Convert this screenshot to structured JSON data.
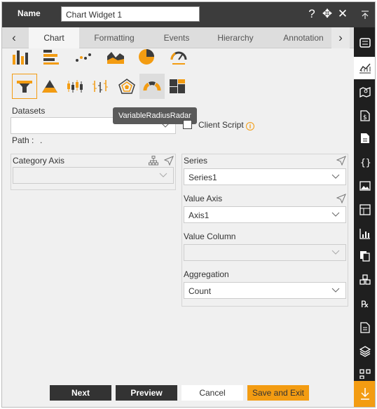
{
  "header": {
    "name_label": "Name",
    "title_value": "Chart Widget 1",
    "help_icon": "question-icon",
    "move_icon": "move-icon",
    "close_icon": "close-icon"
  },
  "tabs": [
    {
      "label": "Chart",
      "active": true
    },
    {
      "label": "Formatting"
    },
    {
      "label": "Events"
    },
    {
      "label": "Hierarchy"
    },
    {
      "label": "Annotation"
    }
  ],
  "chart_types": {
    "row1": [
      "column-chart-icon",
      "bar-chart-icon",
      "scatter-chart-icon",
      "area-chart-icon",
      "pie-chart-icon",
      "gauge-chart-icon"
    ],
    "row2": [
      "funnel-chart-icon",
      "pyramid-chart-icon",
      "candlestick-chart-icon",
      "ohlc-chart-icon",
      "radar-chart-icon",
      "variable-radius-radar-icon",
      "treemap-chart-icon"
    ],
    "selected": "funnel-chart-icon",
    "hovered": "variable-radius-radar-icon"
  },
  "tooltip": "VariableRadiusRadar",
  "datasets": {
    "label": "Datasets",
    "value": "",
    "path_label": "Path :",
    "path_value": "."
  },
  "client_script": {
    "label": "Client Script",
    "checked": false
  },
  "category_axis": {
    "label": "Category Axis",
    "value": ""
  },
  "series": {
    "label": "Series",
    "value": "Series1"
  },
  "value_axis": {
    "label": "Value Axis",
    "value": "Axis1"
  },
  "value_column": {
    "label": "Value Column",
    "value": ""
  },
  "aggregation": {
    "label": "Aggregation",
    "value": "Count"
  },
  "buttons": {
    "next": "Next",
    "preview": "Preview",
    "cancel": "Cancel",
    "save_exit": "Save and Exit"
  },
  "sidebar": {
    "items": [
      "collapse-up-icon",
      "widget-list-icon",
      "chart-icon",
      "map-icon",
      "dollar-doc-icon",
      "document-icon",
      "code-braces-icon",
      "image-icon",
      "grid-layout-icon",
      "bar-chart-icon",
      "copy-icon",
      "cubes-icon",
      "rx-icon",
      "report-icon",
      "layers-icon",
      "qr-icon",
      "download-icon"
    ],
    "active": "chart-icon"
  },
  "colors": {
    "accent": "#f39c12",
    "header": "#3c3c3c",
    "sidebar": "#1f1f1f"
  }
}
